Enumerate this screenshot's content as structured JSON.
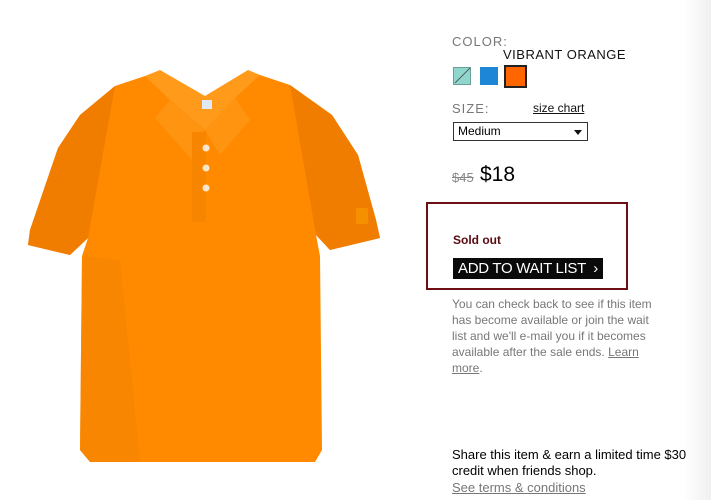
{
  "product": {
    "image_alt": "orange polo shirt",
    "color_label": "COLOR:",
    "color_value": "VIBRANT ORANGE",
    "swatches": [
      {
        "name": "mint",
        "color": "#8fd6cc",
        "available": false
      },
      {
        "name": "blue",
        "color": "#1e86d6",
        "available": true
      },
      {
        "name": "orange",
        "color": "#ff6600",
        "available": true,
        "selected": true
      }
    ],
    "size_label": "SIZE:",
    "size_chart_link": "size chart",
    "size_selected": "Medium",
    "old_price": "$45",
    "new_price": "$18"
  },
  "soldout": {
    "status": "Sold out",
    "button_label": "ADD TO WAIT LIST",
    "button_chevron": "›",
    "info_text": "You can check back to see if this item has become available or join the wait list and we'll e-mail you if it becomes available after the sale ends.",
    "learn_more": "Learn more"
  },
  "share": {
    "text": "Share this item & earn a limited time $30 credit when friends shop.",
    "terms_link": "See terms & conditions"
  },
  "colors": {
    "accent_border": "#6e0f14",
    "shirt": "#ff8a00"
  }
}
